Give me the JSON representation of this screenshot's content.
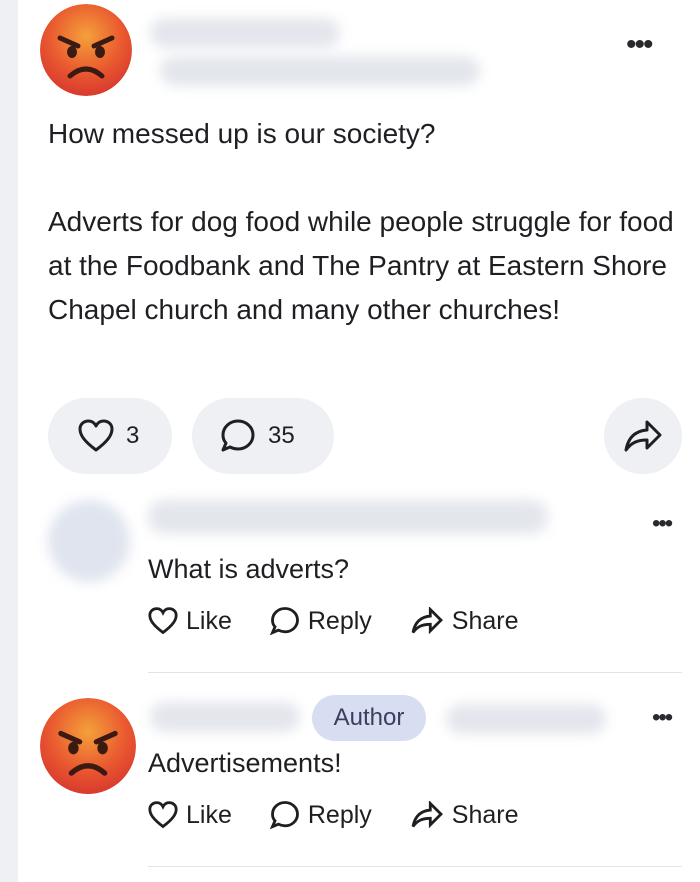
{
  "post": {
    "line1": "How messed up is our society?",
    "body": "Adverts for dog food while people struggle for food at the Foodbank and The Pantry at Eastern Shore Chapel church and many other churches!",
    "likes": "3",
    "comments": "35"
  },
  "comments": [
    {
      "text": "What is adverts?",
      "like_label": "Like",
      "reply_label": "Reply",
      "share_label": "Share"
    },
    {
      "badge": "Author",
      "text": "Advertisements!",
      "like_label": "Like",
      "reply_label": "Reply",
      "share_label": "Share"
    }
  ],
  "icons": [
    "angry-face-emoji",
    "more-dots-icon",
    "heart-icon",
    "comment-bubble-icon",
    "share-arrow-icon"
  ],
  "colors": {
    "pill_bg": "#eef0f4",
    "author_badge_bg": "#d7def2",
    "emoji_red": "#e8453a",
    "emoji_orange": "#f08a2a"
  }
}
